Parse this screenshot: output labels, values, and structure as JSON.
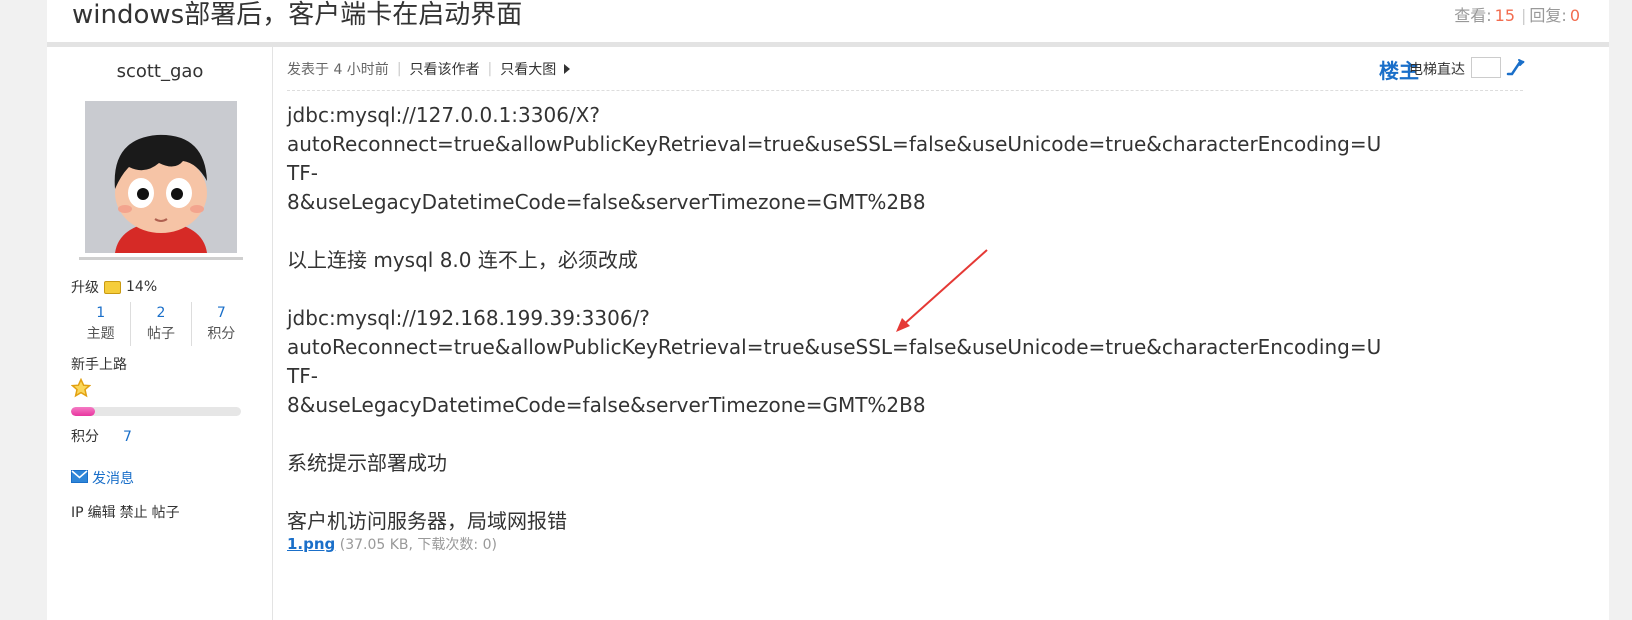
{
  "thread": {
    "title": "windows部署后，客户端卡在启动界面",
    "views_label": "查看:",
    "views": "15",
    "replies_label": "回复:",
    "replies": "0",
    "separator": "|"
  },
  "author": {
    "username": "scott_gao",
    "level_label": "升级",
    "level_progress": "14%",
    "counts": [
      {
        "value": "1",
        "label": "主题"
      },
      {
        "value": "2",
        "label": "帖子"
      },
      {
        "value": "7",
        "label": "积分"
      }
    ],
    "rank_title": "新手上路",
    "rank_progress_fraction": 0.14,
    "points_label": "积分",
    "points_value": "7",
    "send_message": "发消息",
    "admin_links": [
      "IP",
      "编辑",
      "禁止",
      "帖子"
    ]
  },
  "post_meta": {
    "posted": "发表于 4 小时前",
    "only_author": "只看该作者",
    "large_image": "只看大图",
    "floor": "楼主",
    "jump_label": "电梯直达"
  },
  "content": {
    "url1_line1": "jdbc:mysql://127.0.0.1:3306/X?",
    "url1_line2": "autoReconnect=true&allowPublicKeyRetrieval=true&useSSL=false&useUnicode=true&characterEncoding=UTF-",
    "url1_line3": "8&useLegacyDatetimeCode=false&serverTimezone=GMT%2B8",
    "note1": "以上连接 mysql 8.0 连不上，必须改成",
    "url2_line1": "jdbc:mysql://192.168.199.39:3306/?",
    "url2_line2": "autoReconnect=true&allowPublicKeyRetrieval=true&useSSL=false&useUnicode=true&characterEncoding=UTF-",
    "url2_line3": "8&useLegacyDatetimeCode=false&serverTimezone=GMT%2B8",
    "note2": "系统提示部署成功",
    "note3": "客户机访问服务器，局域网报错"
  },
  "attachment": {
    "filename": "1.png",
    "info": "(37.05 KB, 下载次数: 0)"
  },
  "colors": {
    "link": "#1a6fc9",
    "count_highlight": "#f26c4f",
    "arrow": "#e53935",
    "rank_bar": "#e8359f"
  }
}
